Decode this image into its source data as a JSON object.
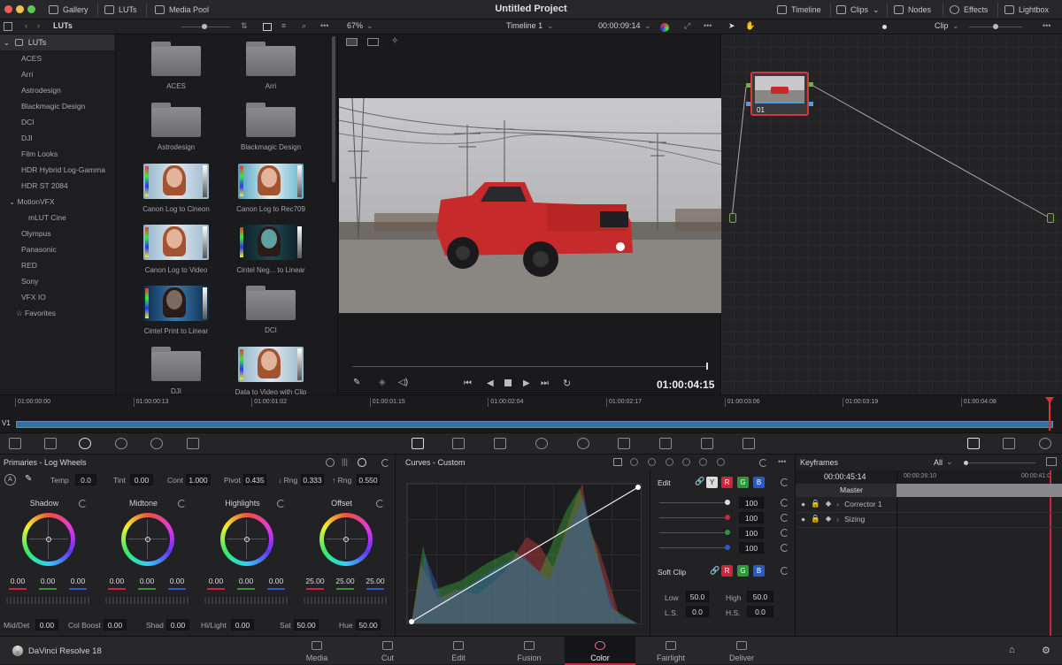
{
  "topbar": {
    "title": "Untitled Project",
    "gallery": "Gallery",
    "luts": "LUTs",
    "media_pool": "Media Pool",
    "timeline": "Timeline",
    "clips": "Clips",
    "nodes": "Nodes",
    "effects": "Effects",
    "lightbox": "Lightbox"
  },
  "secbar": {
    "luts_label": "LUTs",
    "zoom": "67%",
    "timeline_name": "Timeline 1",
    "timecode": "00:00:09:14",
    "clip_label": "Clip"
  },
  "lut_sidebar": {
    "root": "LUTs",
    "items": [
      "ACES",
      "Arri",
      "Astrodesign",
      "Blackmagic Design",
      "DCI",
      "DJI",
      "Film Looks",
      "HDR Hybrid Log-Gamma",
      "HDR ST 2084",
      "MotionVFX",
      "mLUT Cine",
      "Olympus",
      "Panasonic",
      "RED",
      "Sony",
      "VFX IO",
      "Favorites"
    ]
  },
  "lut_grid": [
    "ACES",
    "Arri",
    "Astrodesign",
    "Blackmagic Design",
    "Canon Log to Cineon",
    "Canon Log to Rec709",
    "Canon Log to Video",
    "Cintel Neg... to Linear",
    "Cintel Print to Linear",
    "DCI",
    "DJI",
    "Data to Video with Clip"
  ],
  "viewer": {
    "timecode": "01:00:04:15"
  },
  "node": {
    "label": "01"
  },
  "timeline": {
    "v_label": "V1",
    "ticks": [
      "01:00:00:00",
      "01:00:00:13",
      "01:00:01:02",
      "01:00:01:15",
      "01:00:02:04",
      "01:00:02:17",
      "01:00:03:06",
      "01:00:03:19",
      "01:00:04:08"
    ]
  },
  "primaries": {
    "title": "Primaries - Log Wheels",
    "temp_label": "Temp",
    "temp": "0.0",
    "tint_label": "Tint",
    "tint": "0.00",
    "cont_label": "Cont",
    "cont": "1.000",
    "pivot_label": "Pivot",
    "pivot": "0.435",
    "lrng_label": "↓ Rng",
    "lrng": "0.333",
    "hrng_label": "↑ Rng",
    "hrng": "0.550",
    "wheels": [
      {
        "name": "Shadow",
        "v": [
          "0.00",
          "0.00",
          "0.00"
        ]
      },
      {
        "name": "Midtone",
        "v": [
          "0.00",
          "0.00",
          "0.00"
        ]
      },
      {
        "name": "Highlights",
        "v": [
          "0.00",
          "0.00",
          "0.00"
        ]
      },
      {
        "name": "Offset",
        "v": [
          "25.00",
          "25.00",
          "25.00"
        ]
      }
    ],
    "middet_label": "Mid/Det",
    "middet": "0.00",
    "colboost_label": "Col Boost",
    "colboost": "0.00",
    "shad_label": "Shad",
    "shad": "0.00",
    "hilight_label": "Hi/Light",
    "hilight": "0.00",
    "sat_label": "Sat",
    "sat": "50.00",
    "hue_label": "Hue",
    "hue": "50.00"
  },
  "curves": {
    "title": "Curves - Custom",
    "edit_label": "Edit",
    "y": "Y",
    "r": "R",
    "g": "G",
    "b": "B",
    "vals": [
      "100",
      "100",
      "100",
      "100"
    ],
    "softclip_label": "Soft Clip",
    "low_label": "Low",
    "low": "50.0",
    "high_label": "High",
    "high": "50.0",
    "ls_label": "L.S.",
    "ls": "0.0",
    "hs_label": "H.S.",
    "hs": "0.0"
  },
  "keyframes": {
    "title": "Keyframes",
    "filter": "All",
    "tc": "00:00:45:14",
    "tc_a": "00:00:26:10",
    "tc_b": "00:00:41:0",
    "master": "Master",
    "tracks": [
      "Corrector 1",
      "Sizing"
    ]
  },
  "bottom": {
    "app": "DaVinci Resolve 18",
    "pages": [
      "Media",
      "Cut",
      "Edit",
      "Fusion",
      "Color",
      "Fairlight",
      "Deliver"
    ]
  },
  "colors": {
    "accent_red": "#c8283a",
    "node_border": "#d23a3a",
    "playhead": "#e03030"
  }
}
